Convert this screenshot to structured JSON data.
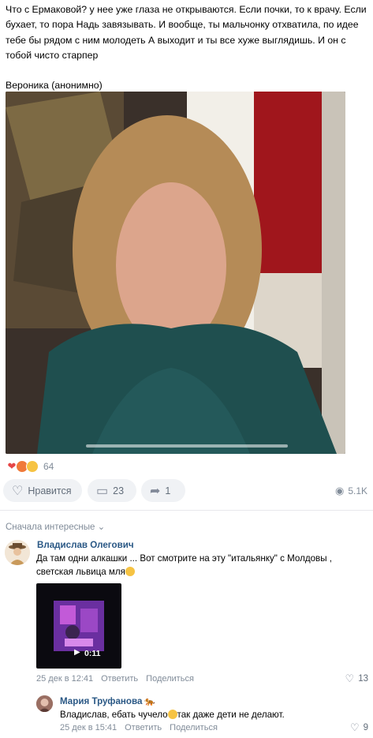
{
  "post": {
    "text": "Что с Ермаковой? у нее уже глаза не открываются. Если почки, то к врачу. Если бухает, то пора Надь завязывать. И вообще, ты мальчонку отхватила, по идее тебе бы рядом с ним молодеть А выходит и ты все хуже выглядишь. И он с тобой чисто старпер",
    "author": "Вероника (анонимно)"
  },
  "reactions": {
    "count": "64"
  },
  "actions": {
    "like_label": "Нравится",
    "comments_count": "23",
    "shares_count": "1",
    "views": "5.1K"
  },
  "comments_header": {
    "sort_label": "Сначала интересные"
  },
  "comments": [
    {
      "name": "Владислав Олегович",
      "text": "Да там одни алкашки ... Вот смотрите на эту \"итальянку\" с Молдовы , светская львица мля",
      "video_duration": "0:11",
      "date": "25 дек в 12:41",
      "reply_label": "Ответить",
      "share_label": "Поделиться",
      "likes": "13"
    }
  ],
  "reply": {
    "name": "Мария Труфанова",
    "text": "Владислав, ебать чучело",
    "text_after": "так даже дети не делают.",
    "date": "25 дек в 15:41",
    "reply_label": "Ответить",
    "share_label": "Поделиться",
    "likes": "9"
  },
  "colors": {
    "link": "#2a5885",
    "muted": "#818c99",
    "pill_bg": "#f0f2f5"
  },
  "icons": [
    "heart-icon",
    "comment-icon",
    "share-icon",
    "eye-icon",
    "play-icon",
    "tiger-icon"
  ]
}
